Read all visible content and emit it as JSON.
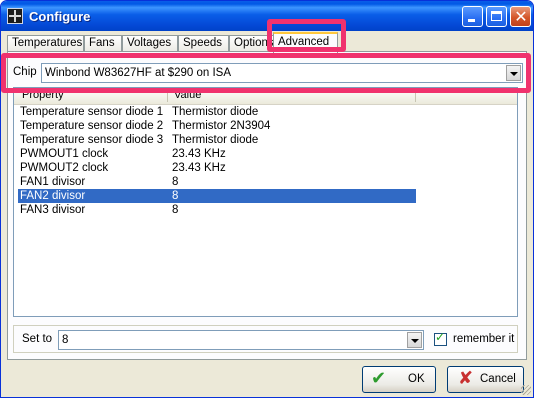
{
  "window": {
    "title": "Configure"
  },
  "tabs": [
    {
      "label": "Temperatures"
    },
    {
      "label": "Fans"
    },
    {
      "label": "Voltages"
    },
    {
      "label": "Speeds"
    },
    {
      "label": "Options"
    },
    {
      "label": "Advanced",
      "active": true
    }
  ],
  "chip": {
    "label": "Chip",
    "value": "Winbond W83627HF at $290 on ISA"
  },
  "table": {
    "headers": {
      "property": "Property",
      "value": "Value"
    },
    "rows": [
      {
        "property": "Temperature sensor diode 1",
        "value": "Thermistor diode"
      },
      {
        "property": "Temperature sensor diode 2",
        "value": "Thermistor 2N3904"
      },
      {
        "property": "Temperature sensor diode 3",
        "value": "Thermistor diode"
      },
      {
        "property": "PWMOUT1 clock",
        "value": "23.43 KHz"
      },
      {
        "property": "PWMOUT2 clock",
        "value": "23.43 KHz"
      },
      {
        "property": "FAN1 divisor",
        "value": "8"
      },
      {
        "property": "FAN2 divisor",
        "value": "8",
        "selected": true
      },
      {
        "property": "FAN3 divisor",
        "value": "8"
      }
    ]
  },
  "setto": {
    "label": "Set to",
    "value": "8",
    "remember_label": "remember it",
    "remember_checked": true
  },
  "buttons": {
    "ok": "OK",
    "cancel": "Cancel"
  },
  "colors": {
    "highlight": "#f0326e",
    "selection": "#316ac5",
    "titlebar": "#0a5ee8"
  }
}
